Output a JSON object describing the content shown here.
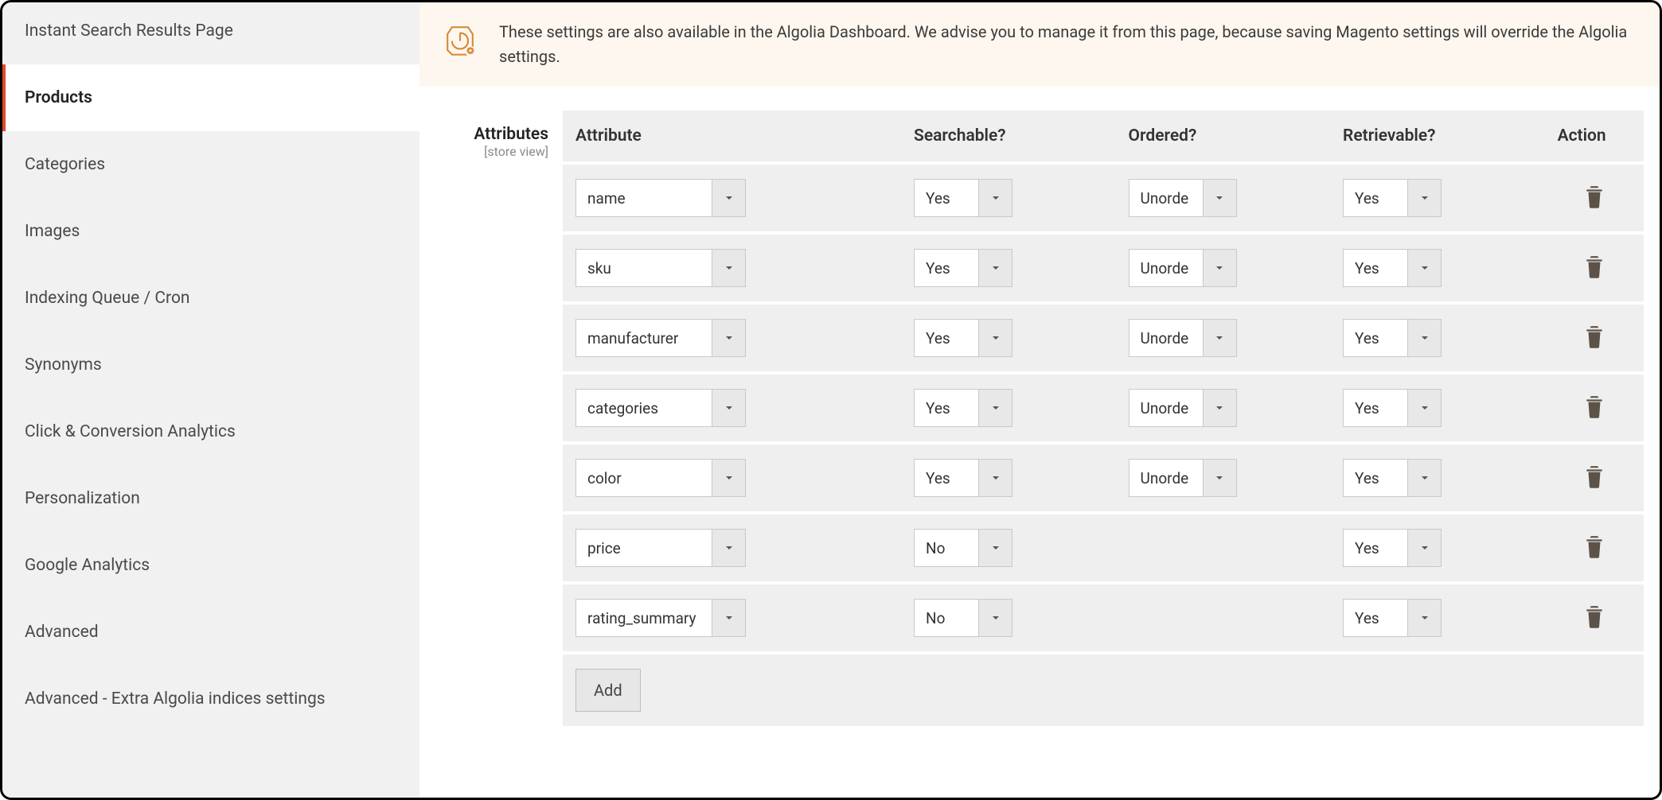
{
  "sidebar": {
    "items": [
      {
        "label": "Instant Search Results Page",
        "active": false
      },
      {
        "label": "Products",
        "active": true
      },
      {
        "label": "Categories",
        "active": false
      },
      {
        "label": "Images",
        "active": false
      },
      {
        "label": "Indexing Queue / Cron",
        "active": false
      },
      {
        "label": "Synonyms",
        "active": false
      },
      {
        "label": "Click & Conversion Analytics",
        "active": false
      },
      {
        "label": "Personalization",
        "active": false
      },
      {
        "label": "Google Analytics",
        "active": false
      },
      {
        "label": "Advanced",
        "active": false
      },
      {
        "label": "Advanced - Extra Algolia indices settings",
        "active": false
      }
    ]
  },
  "notice": {
    "text": "These settings are also available in the Algolia Dashboard. We advise you to manage it from this page, because saving Magento settings will override the Algolia settings."
  },
  "field": {
    "label": "Attributes",
    "scope": "[store view]"
  },
  "table": {
    "headers": {
      "attribute": "Attribute",
      "searchable": "Searchable?",
      "ordered": "Ordered?",
      "retrievable": "Retrievable?",
      "action": "Action"
    },
    "rows": [
      {
        "attribute": "name",
        "searchable": "Yes",
        "ordered": "Unordered",
        "retrievable": "Yes"
      },
      {
        "attribute": "sku",
        "searchable": "Yes",
        "ordered": "Unordered",
        "retrievable": "Yes"
      },
      {
        "attribute": "manufacturer",
        "searchable": "Yes",
        "ordered": "Unordered",
        "retrievable": "Yes"
      },
      {
        "attribute": "categories",
        "searchable": "Yes",
        "ordered": "Unordered",
        "retrievable": "Yes"
      },
      {
        "attribute": "color",
        "searchable": "Yes",
        "ordered": "Unordered",
        "retrievable": "Yes"
      },
      {
        "attribute": "price",
        "searchable": "No",
        "ordered": "",
        "retrievable": "Yes"
      },
      {
        "attribute": "rating_summary",
        "searchable": "No",
        "ordered": "",
        "retrievable": "Yes"
      }
    ],
    "add_label": "Add"
  }
}
